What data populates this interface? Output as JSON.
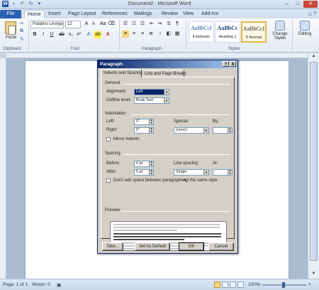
{
  "window": {
    "title": "Document2 - Microsoft Word",
    "logo": "W",
    "qat_icons": [
      "save-icon",
      "undo-icon",
      "redo-icon",
      "customize-icon"
    ],
    "controls": {
      "minimize": "–",
      "maximize": "□",
      "close": "✕"
    }
  },
  "ribbon_tabs": [
    "File",
    "Home",
    "Insert",
    "Page Layout",
    "References",
    "Mailings",
    "Review",
    "View",
    "Add-Ins"
  ],
  "ribbon": {
    "clipboard": {
      "label": "Clipboard",
      "paste": "Paste"
    },
    "font": {
      "label": "Font",
      "family": "Palatino Linotyp",
      "size": "12"
    },
    "paragraph": {
      "label": "Paragraph"
    },
    "styles": {
      "label": "Styles",
      "items": [
        {
          "sample": "AaBbCcI",
          "name": "Emphasis"
        },
        {
          "sample": "AaBbCc",
          "name": "Heading 1"
        },
        {
          "sample": "AaBbCcI",
          "name": "¶ Normal"
        }
      ],
      "change_styles": "Change Styles",
      "editing": "Editing"
    }
  },
  "dialog": {
    "title": "Paragraph",
    "help": "?",
    "close": "X",
    "tabs": [
      "Indents and Spacing",
      "Line and Page Breaks"
    ],
    "general": {
      "heading": "General",
      "alignment_label": "Alignment:",
      "alignment_value": "Left",
      "outline_label": "Outline level:",
      "outline_value": "Body Text"
    },
    "indentation": {
      "heading": "Indentation",
      "left_label": "Left:",
      "left_value": "0\"",
      "right_label": "Right:",
      "right_value": "0\"",
      "special_label": "Special:",
      "special_value": "(none)",
      "by_label": "By:",
      "mirror_label": "Mirror indents"
    },
    "spacing": {
      "heading": "Spacing",
      "before_label": "Before:",
      "before_value": "0 pt",
      "after_label": "After:",
      "after_value": "0 pt",
      "line_label": "Line spacing:",
      "line_value": "Single",
      "at_label": "At:",
      "dont_add_label": "Don't add space between paragraphs of the same style"
    },
    "preview": {
      "heading": "Preview"
    },
    "buttons": {
      "tabs": "Tabs...",
      "default": "Set As Default",
      "ok": "OK",
      "cancel": "Cancel"
    }
  },
  "status": {
    "page": "Page: 1 of 1",
    "words": "Words: 0",
    "zoom": "100%",
    "zoom_minus": "–",
    "zoom_plus": "+"
  }
}
